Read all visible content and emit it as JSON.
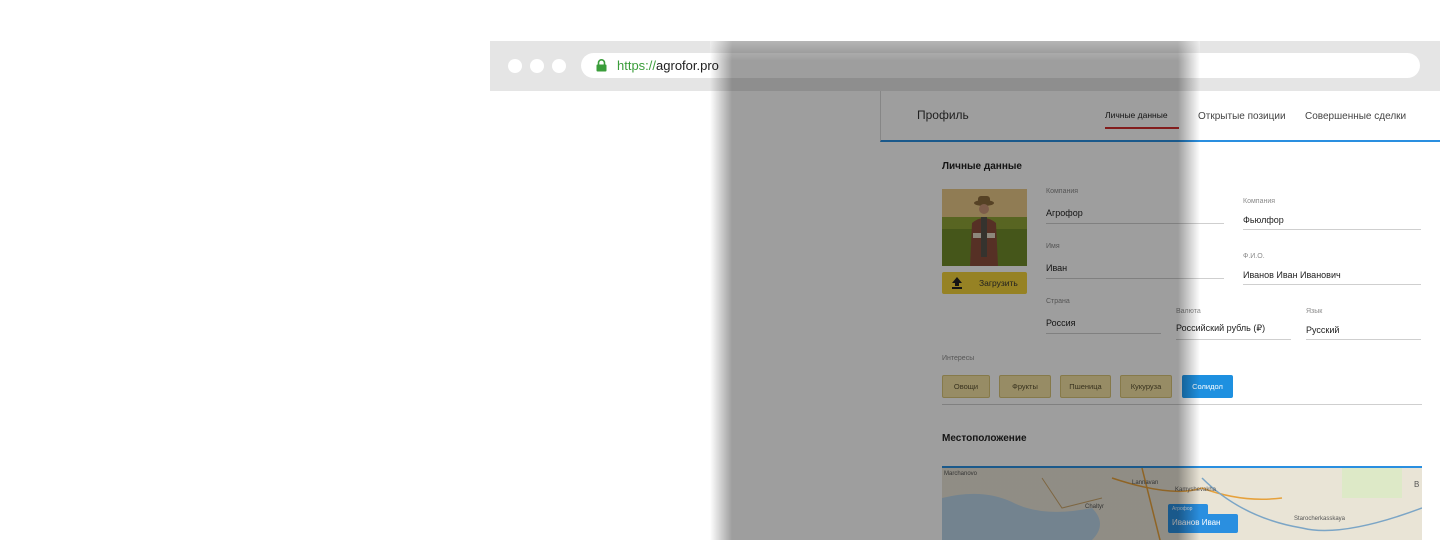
{
  "browser": {
    "url_protocol": "https://",
    "url_host": "agrofor.pro",
    "window_dots": [
      "close",
      "minimize",
      "maximize"
    ],
    "icon": "lock-icon",
    "lock_color": "#3a9d3a"
  },
  "header": {
    "title": "Профиль",
    "tabs": [
      {
        "label": "Личные данные",
        "active": true
      },
      {
        "label": "Открытые позиции",
        "active": false
      },
      {
        "label": "Совершенные сделки",
        "active": false
      }
    ],
    "accent_color": "#2a8fe0",
    "active_tab_color": "#d32f2f"
  },
  "personal": {
    "section_title": "Личные данные",
    "upload_label": "Загрузить",
    "upload_icon": "upload-icon",
    "fields": {
      "company_left": {
        "label": "Компания",
        "value": "Агрофор"
      },
      "name": {
        "label": "Имя",
        "value": "Иван"
      },
      "country": {
        "label": "Страна",
        "value": "Россия"
      },
      "company_right": {
        "label": "Компания",
        "value": "Фьюлфор"
      },
      "fio": {
        "label": "Ф.И.О.",
        "value": "Иванов Иван Иванович"
      },
      "currency": {
        "label": "Валюта",
        "value": "Российский рубль (₽)"
      },
      "language": {
        "label": "Язык",
        "value": "Русский"
      }
    },
    "interests_label": "Интересы",
    "interests": [
      {
        "label": "Овощи",
        "active": false
      },
      {
        "label": "Фрукты",
        "active": false
      },
      {
        "label": "Пшеница",
        "active": false
      },
      {
        "label": "Кукуруза",
        "active": false
      },
      {
        "label": "Солидол",
        "active": true
      }
    ]
  },
  "location": {
    "section_title": "Местоположение",
    "map_labels": [
      "Marchanovo",
      "Lannavan",
      "Kamyshevakha",
      "Chaltyr",
      "Starocherkasskaya",
      "B"
    ],
    "marker_small": "Агрофор",
    "marker_label": "Иванов Иван"
  }
}
